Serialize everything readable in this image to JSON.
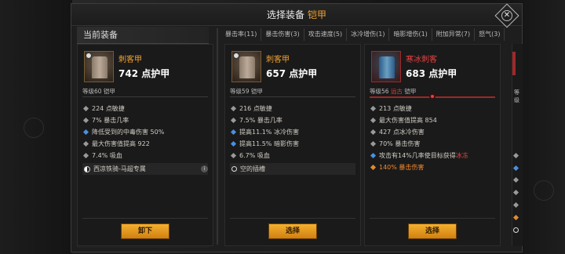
{
  "header": {
    "title_prefix": "选择装备",
    "title_highlight": "铠甲"
  },
  "left_panel": {
    "title": "当前装备"
  },
  "filters": [
    "暴击率(11)",
    "暴击伤害(3)",
    "攻击速度(5)",
    "冰冷增伤(1)",
    "暗影增伤(1)",
    "附加异常(7)",
    "怒气(3)"
  ],
  "cards": [
    {
      "name": "刺客甲",
      "armor": "742 点护甲",
      "level": "等级60 铠甲",
      "button": "卸下",
      "stats": [
        {
          "text": "224 点敏捷",
          "kind": "gray"
        },
        {
          "text": "7% 暴击几率",
          "kind": "gray"
        },
        {
          "text": "降低受到的中毒伤害 50%",
          "kind": "blue"
        },
        {
          "text": "最大伤害值提高 922",
          "kind": "gray"
        },
        {
          "text": "7.4% 吸血",
          "kind": "gray"
        }
      ],
      "set": "西凉铁骑-马超专属"
    },
    {
      "name": "刺客甲",
      "armor": "657 点护甲",
      "level": "等级59 铠甲",
      "button": "选择",
      "stats": [
        {
          "text": "216 点敏捷",
          "kind": "gray"
        },
        {
          "text": "7.5% 暴击几率",
          "kind": "gray"
        },
        {
          "text": "提高11.1% 冰冷伤害",
          "kind": "blue"
        },
        {
          "text": "提高11.5% 暗影伤害",
          "kind": "blue"
        },
        {
          "text": "6.7% 吸血",
          "kind": "gray"
        }
      ],
      "socket": "空的插槽"
    },
    {
      "name": "寒冰刺客",
      "armor": "683 点护甲",
      "level_prefix": "等级56",
      "level_tag": "远古",
      "level_suffix": "铠甲",
      "button": "选择",
      "stats": [
        {
          "text": "213 点敏捷",
          "kind": "gray"
        },
        {
          "text": "最大伤害值提高 854",
          "kind": "gray"
        },
        {
          "text": "427 点冰冷伤害",
          "kind": "gray"
        },
        {
          "text": "70% 暴击伤害",
          "kind": "gray"
        }
      ],
      "special_prefix": "攻击有14%几率使目标获得",
      "special_tag": "冰冻",
      "orange_stat": "140% 暴击伤害"
    }
  ],
  "peek": {
    "level": "等级"
  },
  "colors": {
    "accent": "#f0a030",
    "legendary_red": "#e84040",
    "magic_blue": "#4a90e0",
    "button": "#e8a020"
  }
}
